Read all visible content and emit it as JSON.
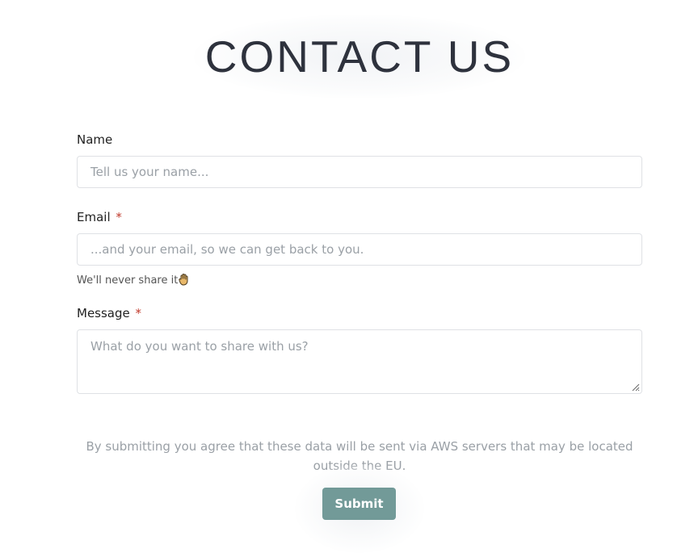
{
  "header": {
    "title": "CONTACT US"
  },
  "form": {
    "name": {
      "label": "Name",
      "placeholder": "Tell us your name..."
    },
    "email": {
      "label": "Email",
      "required_mark": "*",
      "placeholder": "...and your email, so we can get back to you.",
      "hint": "We'll never share it"
    },
    "message": {
      "label": "Message",
      "required_mark": "*",
      "placeholder": "What do you want to share with us?"
    },
    "disclaimer": "By submitting you agree that these data will be sent via AWS servers that may be located outside the EU.",
    "submit_label": "Submit"
  },
  "colors": {
    "accent": "#729a98",
    "required": "#c0392b"
  },
  "icons": {
    "hint_icon": "raised-hand-icon"
  }
}
